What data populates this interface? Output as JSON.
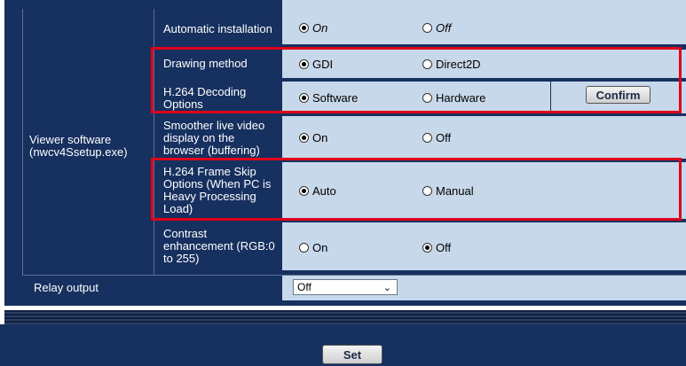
{
  "group": {
    "label": "Viewer software (nwcv4Ssetup.exe)"
  },
  "rows": [
    {
      "label": "Automatic installation",
      "opt1": "On",
      "opt2": "Off",
      "selected": 1
    },
    {
      "label": "Drawing method",
      "opt1": "GDI",
      "opt2": "Direct2D",
      "selected": 1
    },
    {
      "label": "H.264 Decoding Options",
      "opt1": "Software",
      "opt2": "Hardware",
      "selected": 1,
      "button": "Confirm"
    },
    {
      "label": "Smoother live video display on the browser (buffering)",
      "opt1": "On",
      "opt2": "Off",
      "selected": 1
    },
    {
      "label": "H.264 Frame Skip Options (When PC is Heavy Processing Load)",
      "opt1": "Auto",
      "opt2": "Manual",
      "selected": 1
    },
    {
      "label": "Contrast enhancement (RGB:0 to 255)",
      "opt1": "On",
      "opt2": "Off",
      "selected": 2
    }
  ],
  "relay": {
    "label": "Relay output",
    "value": "Off"
  },
  "footer": {
    "set_label": "Set"
  },
  "colors": {
    "navy": "#16305f",
    "panel": "#c7d8ea",
    "highlight": "#e0001a"
  }
}
